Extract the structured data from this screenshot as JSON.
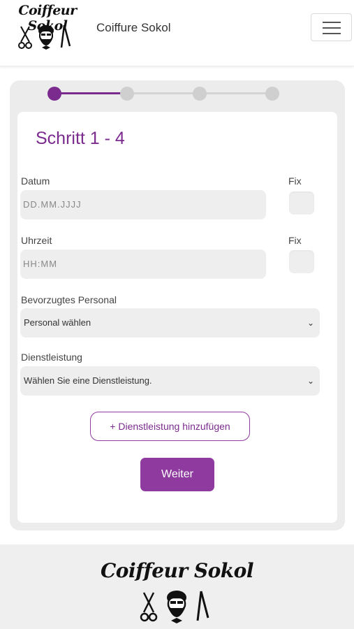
{
  "header": {
    "logo_text": "Coiffeur Sokol",
    "brand_title": "Coiffure Sokol",
    "menu_icon": "hamburger-icon"
  },
  "wizard": {
    "current_step": 1,
    "total_steps": 4,
    "title": "Schritt 1 - 4",
    "accent_color": "#7b2b8e"
  },
  "form": {
    "date_label": "Datum",
    "date_placeholder": "DD.MM.JJJJ",
    "date_fix_label": "Fix",
    "time_label": "Uhrzeit",
    "time_placeholder": "HH:MM",
    "time_fix_label": "Fix",
    "staff_label": "Bevorzugtes Personal",
    "staff_selected": "Personal wählen",
    "service_label": "Dienstleistung",
    "service_selected": "Wählen Sie eine Dienstleistung.",
    "add_service_label": "+ Dienstleistung hinzufügen",
    "next_label": "Weiter"
  },
  "footer": {
    "logo_text": "Coiffeur Sokol"
  }
}
